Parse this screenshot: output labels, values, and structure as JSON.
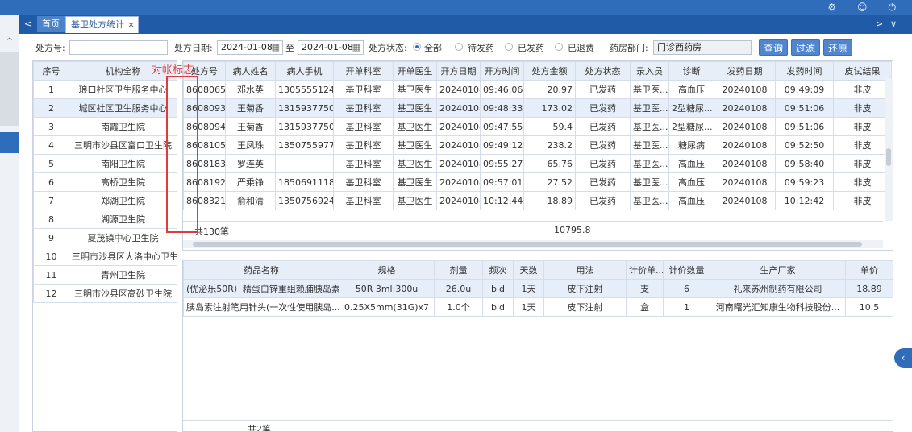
{
  "tabs": {
    "home": "首页",
    "active": "基卫处方统计",
    "close": "×",
    "back_arrow": "<",
    "fwd_arrow": ">",
    "menu_arrow": "∨"
  },
  "search": {
    "rx_no_label": "处方号:",
    "rx_no_value": "",
    "date_label": "处方日期:",
    "date_from": "2024-01-08",
    "date_to_label": "至",
    "date_to": "2024-01-08",
    "status_label": "处方状态:",
    "status_options": [
      "全部",
      "待发药",
      "已发药",
      "已退费"
    ],
    "pharmacy_label": "药房部门:",
    "pharmacy_value": "门诊西药房",
    "btn_query": "查询",
    "btn_filter": "过滤",
    "btn_reset": "还原"
  },
  "annotation": "对帐标志",
  "org_table": {
    "headers": [
      "序号",
      "机构全称"
    ],
    "rows": [
      [
        "1",
        "琅口社区卫生服务中心"
      ],
      [
        "2",
        "城区社区卫生服务中心"
      ],
      [
        "3",
        "南霞卫生院"
      ],
      [
        "4",
        "三明市沙县区富口卫生院"
      ],
      [
        "5",
        "南阳卫生院"
      ],
      [
        "6",
        "高桥卫生院"
      ],
      [
        "7",
        "郑湖卫生院"
      ],
      [
        "8",
        "湖源卫生院"
      ],
      [
        "9",
        "夏茂镇中心卫生院"
      ],
      [
        "10",
        "三明市沙县区大洛中心卫生院"
      ],
      [
        "11",
        "青州卫生院"
      ],
      [
        "12",
        "三明市沙县区高砂卫生院"
      ]
    ]
  },
  "rx_table": {
    "headers": [
      "处方号",
      "病人姓名",
      "病人手机",
      "开单科室",
      "开单医生",
      "开方日期",
      "开方时间",
      "处方金额",
      "处方状态",
      "录入员",
      "诊断",
      "发药日期",
      "发药时间",
      "皮试结果"
    ],
    "rows": [
      [
        "8608065",
        "邓水英",
        "13055551242",
        "基卫科室",
        "基卫医生",
        "20240108",
        "09:46:06",
        "20.97",
        "已发药",
        "基卫医...",
        "高血压",
        "20240108",
        "09:49:09",
        "非皮"
      ],
      [
        "8608093",
        "王菊香",
        "13159377503",
        "基卫科室",
        "基卫医生",
        "20240108",
        "09:48:33",
        "173.02",
        "已发药",
        "基卫医...",
        "2型糖尿...",
        "20240108",
        "09:51:06",
        "非皮"
      ],
      [
        "8608094",
        "王菊香",
        "13159377503",
        "基卫科室",
        "基卫医生",
        "20240108",
        "09:47:55",
        "59.4",
        "已发药",
        "基卫医...",
        "2型糖尿...",
        "20240108",
        "09:51:06",
        "非皮"
      ],
      [
        "8608105",
        "王凤珠",
        "13507559779",
        "基卫科室",
        "基卫医生",
        "20240108",
        "09:49:12",
        "238.2",
        "已发药",
        "基卫医...",
        "糖尿病",
        "20240108",
        "09:52:50",
        "非皮"
      ],
      [
        "8608183",
        "罗连英",
        "",
        "基卫科室",
        "基卫医生",
        "20240108",
        "09:55:27",
        "65.76",
        "已发药",
        "基卫医...",
        "高血压",
        "20240108",
        "09:58:40",
        "非皮"
      ],
      [
        "8608192",
        "严乘铮",
        "18506911182",
        "基卫科室",
        "基卫医生",
        "20240108",
        "09:57:01",
        "27.52",
        "已发药",
        "基卫医...",
        "高血压",
        "20240108",
        "09:59:23",
        "非皮"
      ],
      [
        "8608321",
        "俞和清",
        "13507569249",
        "基卫科室",
        "基卫医生",
        "20240108",
        "10:12:44",
        "18.89",
        "已发药",
        "基卫医...",
        "高血压",
        "20240108",
        "10:12:42",
        "非皮"
      ]
    ],
    "footer_count": "共130笔",
    "footer_total": "10795.8"
  },
  "drug_table": {
    "headers": [
      "药品名称",
      "规格",
      "剂量",
      "频次",
      "天数",
      "用法",
      "计价单...",
      "计价数量",
      "生产厂家",
      "单价"
    ],
    "rows": [
      [
        "(优泌乐50R）精蛋白锌重组赖脯胰岛素...",
        "50R 3ml:300u",
        "26.0u",
        "bid",
        "1天",
        "皮下注射",
        "支",
        "6",
        "礼来苏州制药有限公司",
        "18.89"
      ],
      [
        "胰岛素注射笔用针头(一次性使用胰岛...",
        "0.25X5mm(31G)x7",
        "1.0个",
        "bid",
        "1天",
        "皮下注射",
        "盒",
        "1",
        "河南曙光汇知康生物科技股份...",
        "10.5"
      ]
    ],
    "footer_count": "共2笔"
  }
}
